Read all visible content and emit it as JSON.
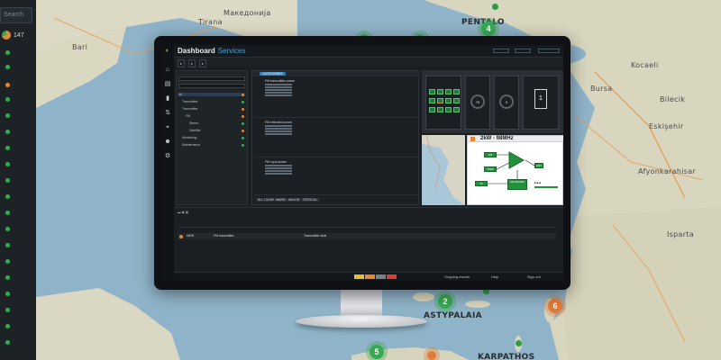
{
  "sidebar": {
    "search_placeholder": "Search",
    "device_count": "147"
  },
  "map": {
    "labels": {
      "tirana": "Tirana",
      "macedonia": "Македонија",
      "pentalofos": "PENTALO",
      "bursa": "Bursa",
      "kocaeli": "Kocaeli",
      "bilecik": "Bilecik",
      "eskisehir": "Eskişehir",
      "afyon": "Afyonkarahisar",
      "isparta": "Isparta",
      "astypalaia": "ASTYPALAIA",
      "karpathos": "KARPATHOS",
      "bari": "Bari"
    },
    "clusters": {
      "pentalo": "4",
      "astypalaia": "2",
      "dodecanese": "6",
      "crete": "5"
    }
  },
  "app": {
    "title": "Dashboard",
    "subtitle": "Services",
    "panels": {
      "tree_header": "Network",
      "category": "CATEGORIES"
    },
    "tree": [
      "All",
      "Transmitter",
      "Transmitter",
      "FM",
      "Stereo",
      "Satellite",
      "Monitoring",
      "Maintenance"
    ],
    "services": [
      "FM transmitter power",
      "FM reflected power",
      "FM input power"
    ],
    "footer_buttons": [
      "ALL CLEAR",
      "WARN",
      "MAJOR",
      "CRITICAL"
    ],
    "signal": {
      "title": "2kW - 98MHz",
      "blocks": [
        "FM",
        "PWR",
        "TX",
        "ANT",
        "RECEIVER"
      ]
    },
    "gauges": [
      "75",
      "0"
    ],
    "alarm": {
      "type": "NEW",
      "device": "FM transmitter",
      "message": "Transmitter fault"
    },
    "status_bar": {
      "left": "Ongoing events",
      "center": "Help",
      "right": "Sign out"
    }
  },
  "colors": {
    "accent": "#3fa6e0",
    "ok": "#38a852",
    "warn": "#e07b3a"
  }
}
